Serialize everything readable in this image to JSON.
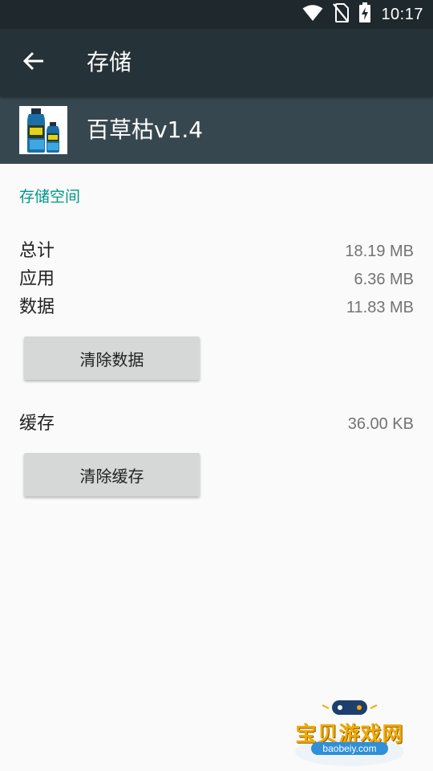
{
  "status_bar": {
    "time": "10:17",
    "icons": [
      "wifi-icon",
      "no-sim-icon",
      "battery-charging-icon"
    ]
  },
  "toolbar": {
    "back_icon": "arrow-back-icon",
    "title": "存储"
  },
  "app": {
    "name": "百草枯v1.4",
    "icon": "app-bottle-icon"
  },
  "storage": {
    "section_title": "存储空间",
    "rows": [
      {
        "label": "总计",
        "value": "18.19 MB"
      },
      {
        "label": "应用",
        "value": "6.36 MB"
      },
      {
        "label": "数据",
        "value": "11.83 MB"
      }
    ],
    "clear_data_label": "清除数据",
    "cache_label": "缓存",
    "cache_value": "36.00 KB",
    "clear_cache_label": "清除缓存"
  },
  "watermark": {
    "text": "宝贝游戏网",
    "url": "baobeiy.com"
  },
  "colors": {
    "status_bar": "#1e282d",
    "toolbar": "#253238",
    "app_header": "#37474f",
    "accent": "#009688",
    "button": "#d6d7d7",
    "background": "#fafafa"
  }
}
